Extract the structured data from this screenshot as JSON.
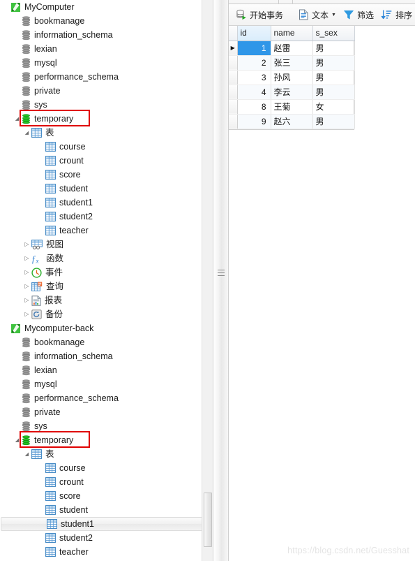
{
  "left_panel": {
    "tree": [
      {
        "level": 0,
        "arrow": "none",
        "icon": "connection-icon",
        "label": "MyComputer"
      },
      {
        "level": 1,
        "arrow": "none",
        "icon": "database-icon",
        "label": "bookmanage"
      },
      {
        "level": 1,
        "arrow": "none",
        "icon": "database-icon",
        "label": "information_schema"
      },
      {
        "level": 1,
        "arrow": "none",
        "icon": "database-icon",
        "label": "lexian"
      },
      {
        "level": 1,
        "arrow": "none",
        "icon": "database-icon",
        "label": "mysql"
      },
      {
        "level": 1,
        "arrow": "none",
        "icon": "database-icon",
        "label": "performance_schema"
      },
      {
        "level": 1,
        "arrow": "none",
        "icon": "database-icon",
        "label": "private"
      },
      {
        "level": 1,
        "arrow": "none",
        "icon": "database-icon",
        "label": "sys"
      },
      {
        "level": 1,
        "arrow": "open",
        "icon": "database-open-icon",
        "label": "temporary",
        "highlighted": true
      },
      {
        "level": 2,
        "arrow": "open",
        "icon": "table-folder-icon",
        "label": "表"
      },
      {
        "level": 3,
        "arrow": "none",
        "icon": "table-icon",
        "label": "course"
      },
      {
        "level": 3,
        "arrow": "none",
        "icon": "table-icon",
        "label": "crount"
      },
      {
        "level": 3,
        "arrow": "none",
        "icon": "table-icon",
        "label": "score"
      },
      {
        "level": 3,
        "arrow": "none",
        "icon": "table-icon",
        "label": "student"
      },
      {
        "level": 3,
        "arrow": "none",
        "icon": "table-icon",
        "label": "student1"
      },
      {
        "level": 3,
        "arrow": "none",
        "icon": "table-icon",
        "label": "student2"
      },
      {
        "level": 3,
        "arrow": "none",
        "icon": "table-icon",
        "label": "teacher"
      },
      {
        "level": 2,
        "arrow": "closed",
        "icon": "view-icon",
        "label": "视图"
      },
      {
        "level": 2,
        "arrow": "closed",
        "icon": "function-icon",
        "label": "函数"
      },
      {
        "level": 2,
        "arrow": "closed",
        "icon": "event-icon",
        "label": "事件"
      },
      {
        "level": 2,
        "arrow": "closed",
        "icon": "query-icon",
        "label": "查询"
      },
      {
        "level": 2,
        "arrow": "closed",
        "icon": "report-icon",
        "label": "报表"
      },
      {
        "level": 2,
        "arrow": "closed",
        "icon": "backup-icon",
        "label": "备份"
      },
      {
        "level": 0,
        "arrow": "none",
        "icon": "connection-icon",
        "label": "Mycomputer-back"
      },
      {
        "level": 1,
        "arrow": "none",
        "icon": "database-icon",
        "label": "bookmanage"
      },
      {
        "level": 1,
        "arrow": "none",
        "icon": "database-icon",
        "label": "information_schema"
      },
      {
        "level": 1,
        "arrow": "none",
        "icon": "database-icon",
        "label": "lexian"
      },
      {
        "level": 1,
        "arrow": "none",
        "icon": "database-icon",
        "label": "mysql"
      },
      {
        "level": 1,
        "arrow": "none",
        "icon": "database-icon",
        "label": "performance_schema"
      },
      {
        "level": 1,
        "arrow": "none",
        "icon": "database-icon",
        "label": "private"
      },
      {
        "level": 1,
        "arrow": "none",
        "icon": "database-icon",
        "label": "sys"
      },
      {
        "level": 1,
        "arrow": "open",
        "icon": "database-open-icon",
        "label": "temporary",
        "highlighted": true
      },
      {
        "level": 2,
        "arrow": "open",
        "icon": "table-folder-icon",
        "label": "表"
      },
      {
        "level": 3,
        "arrow": "none",
        "icon": "table-icon",
        "label": "course"
      },
      {
        "level": 3,
        "arrow": "none",
        "icon": "table-icon",
        "label": "crount"
      },
      {
        "level": 3,
        "arrow": "none",
        "icon": "table-icon",
        "label": "score"
      },
      {
        "level": 3,
        "arrow": "none",
        "icon": "table-icon",
        "label": "student"
      },
      {
        "level": 3,
        "arrow": "none",
        "icon": "table-icon",
        "label": "student1",
        "selected": true
      },
      {
        "level": 3,
        "arrow": "none",
        "icon": "table-icon",
        "label": "student2"
      },
      {
        "level": 3,
        "arrow": "none",
        "icon": "table-icon",
        "label": "teacher"
      }
    ],
    "annotation_color": "#e00000"
  },
  "toolbar": {
    "start_transaction_label": "开始事务",
    "text_label": "文本",
    "filter_label": "筛选",
    "sort_label": "排序"
  },
  "grid": {
    "columns": [
      "id",
      "name",
      "s_sex"
    ],
    "rows": [
      {
        "id": "1",
        "name": "赵雷",
        "s_sex": "男",
        "current": true
      },
      {
        "id": "2",
        "name": "张三",
        "s_sex": "男"
      },
      {
        "id": "3",
        "name": "孙风",
        "s_sex": "男"
      },
      {
        "id": "4",
        "name": "李云",
        "s_sex": "男"
      },
      {
        "id": "8",
        "name": "王菊",
        "s_sex": "女"
      },
      {
        "id": "9",
        "name": "赵六",
        "s_sex": "男"
      }
    ],
    "selected_column": "id"
  },
  "watermark": {
    "text": "https://blog.csdn.net/Guesshat"
  }
}
